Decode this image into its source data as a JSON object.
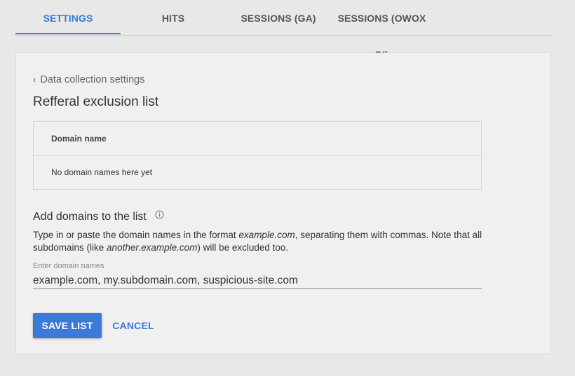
{
  "tabs": [
    {
      "label": "SETTINGS",
      "active": true
    },
    {
      "label": "HITS",
      "active": false
    },
    {
      "label": "SESSIONS (GA)",
      "active": false
    },
    {
      "label": "SESSIONS (OWOX BI)",
      "active": false
    }
  ],
  "accent_color": "#3b7ad9",
  "breadcrumb": {
    "label": "Data collection settings",
    "icon": "chevron-left-icon"
  },
  "page_title": "Refferal exclusion list",
  "table": {
    "header": "Domain name",
    "empty_text": "No domain names here yet"
  },
  "add_section": {
    "heading": "Add domains to the list",
    "info_icon": "info-icon",
    "help_text_1": "Type in or paste the domain names in the format ",
    "help_example_1": "example.com",
    "help_text_2": ", separating them with commas. Note that all subdomains (like ",
    "help_example_2": "another.example.com",
    "help_text_3": ") will be excluded too.",
    "input_label": "Enter domain names",
    "input_value": "example.com, my.subdomain.com, suspicious-site.com"
  },
  "buttons": {
    "save": "SAVE LIST",
    "cancel": "CANCEL"
  }
}
